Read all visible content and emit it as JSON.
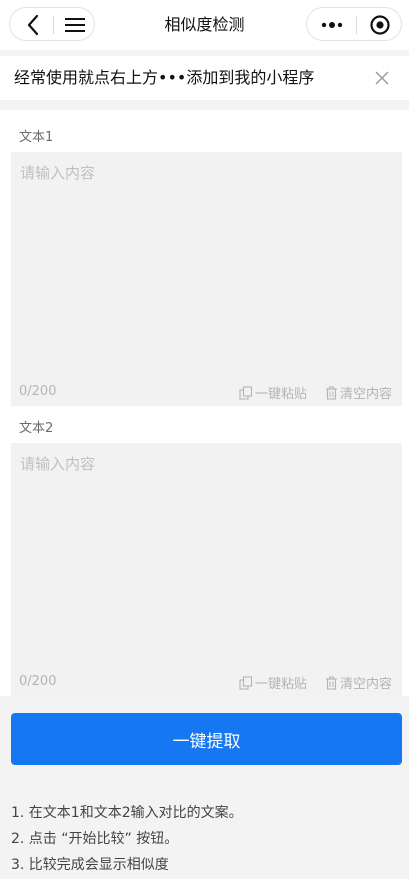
{
  "nav": {
    "title": "相似度检测",
    "back_icon": "chevron-left-icon",
    "menu_icon": "hamburger-icon",
    "more_icon": "more-dots-icon",
    "close_icon": "target-circle-icon"
  },
  "banner": {
    "text": "经常使用就点右上方•••添加到我的小程序"
  },
  "text1": {
    "label": "文本1",
    "placeholder": "请输入内容",
    "value": "",
    "counter": "0/200",
    "paste_label": "一键粘贴",
    "clear_label": "清空内容"
  },
  "text2": {
    "label": "文本2",
    "placeholder": "请输入内容",
    "value": "",
    "counter": "0/200",
    "paste_label": "一键粘贴",
    "clear_label": "清空内容"
  },
  "submit": {
    "label": "一键提取"
  },
  "instructions": [
    "1. 在文本1和文本2输入对比的文案。",
    "2. 点击 “开始比较” 按钮。",
    "3. 比较完成会显示相似度"
  ],
  "colors": {
    "primary": "#1677f3",
    "panel_bg": "#ffffff",
    "input_bg": "#f2f2f2",
    "page_bg": "#f3f3f3"
  }
}
